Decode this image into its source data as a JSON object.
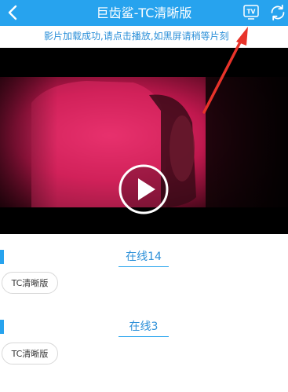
{
  "header": {
    "title": "巨齿鲨-TC清晰版",
    "back_icon": "chevron-left-icon",
    "tv_icon": "tv-cast-icon",
    "tv_label": "TV",
    "refresh_icon": "refresh-icon"
  },
  "notice": {
    "text": "影片加载成功,请点击播放,如黑屏请稍等片刻"
  },
  "player": {
    "play_icon": "play-icon"
  },
  "sources": [
    {
      "title": "在线14",
      "episodes": [
        "TC清晰版"
      ]
    },
    {
      "title": "在线3",
      "episodes": [
        "TC清晰版"
      ]
    }
  ],
  "colors": {
    "accent": "#27a3ee",
    "notice_text": "#2b8fd8",
    "arrow": "#e8332a"
  }
}
